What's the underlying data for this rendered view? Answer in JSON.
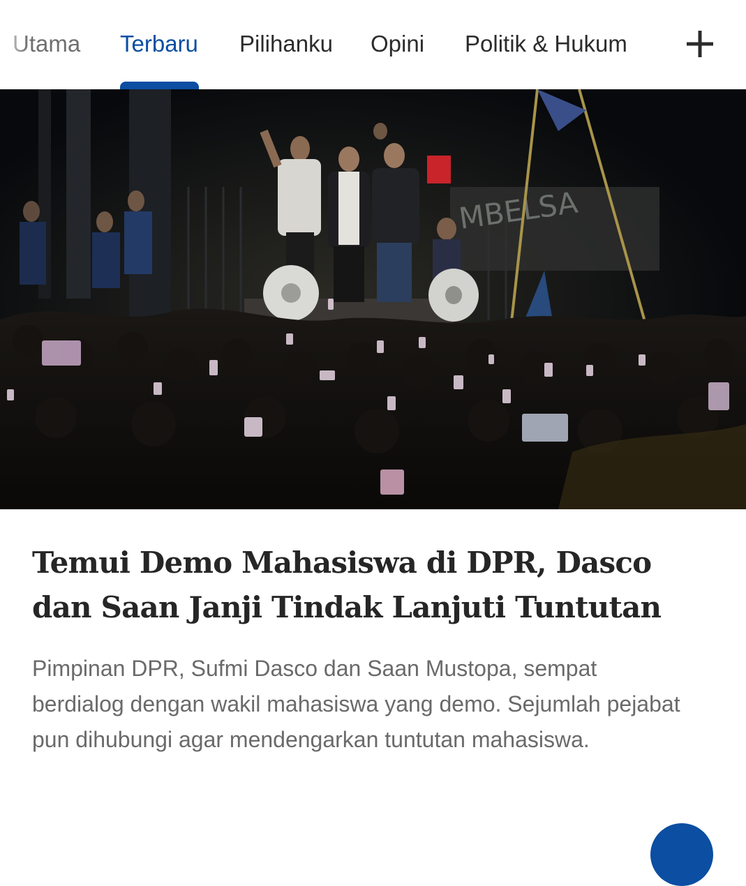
{
  "nav": {
    "tabs": [
      {
        "label": "Utama",
        "active": false
      },
      {
        "label": "Terbaru",
        "active": true
      },
      {
        "label": "Pilihanku",
        "active": false
      },
      {
        "label": "Opini",
        "active": false
      },
      {
        "label": "Politik & Hukum",
        "active": false
      }
    ],
    "more_icon": "plus-icon",
    "active_color": "#0b4ea2"
  },
  "article": {
    "image": {
      "visible_text": "MBELSA"
    },
    "title": "Temui Demo Mahasiswa di DPR, Dasco dan Saan Janji Tindak Lanjuti Tuntutan",
    "summary": "Pimpinan DPR, Sufmi Dasco dan Saan Mustopa, sempat berdialog dengan wakil mahasiswa yang demo. Sejumlah pejabat pun dihubungi agar mendengarkan tuntutan mahasiswa."
  },
  "fab": {
    "icon": "circle-button-icon",
    "color": "#0b4ea2"
  }
}
